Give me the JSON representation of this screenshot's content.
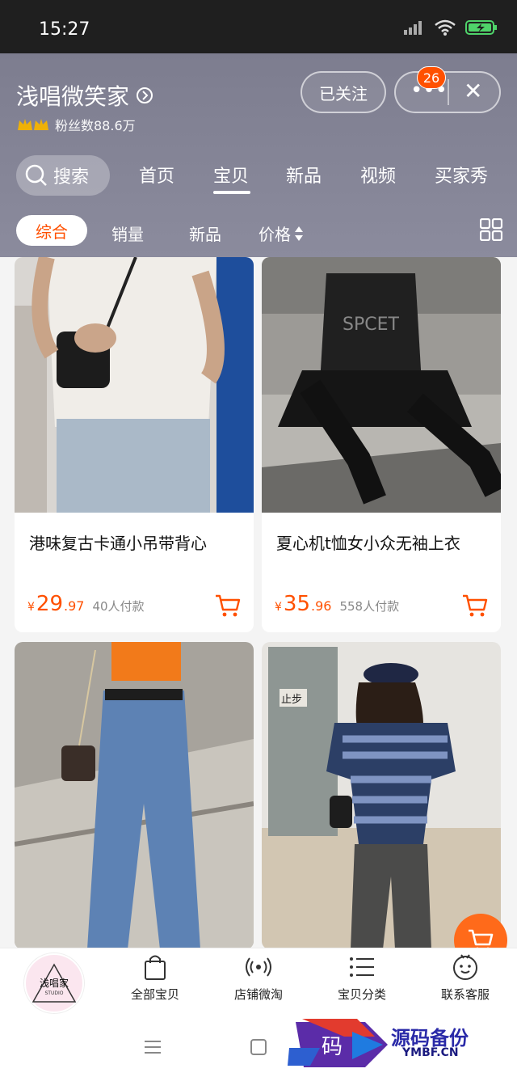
{
  "status": {
    "time": "15:27"
  },
  "shop": {
    "name": "浅唱微笑家",
    "fans": "粉丝数88.6万",
    "follow_label": "已关注",
    "badge_count": "26"
  },
  "nav": {
    "search_label": "搜索",
    "tabs": [
      "首页",
      "宝贝",
      "新品",
      "视频",
      "买家秀"
    ]
  },
  "filter": {
    "chips": [
      "综合",
      "销量",
      "新品",
      "价格"
    ]
  },
  "products": [
    {
      "title": "港味复古卡通小吊带背心",
      "price_yen": "¥",
      "price_int": "29",
      "price_dec": ".97",
      "paid": "40人付款"
    },
    {
      "title": "夏心机t恤女小众无袖上衣",
      "price_yen": "¥",
      "price_int": "35",
      "price_dec": ".96",
      "paid": "558人付款"
    },
    {
      "title": "",
      "price_yen": "",
      "price_int": "",
      "price_dec": "",
      "paid": ""
    },
    {
      "title": "",
      "price_yen": "",
      "price_int": "",
      "price_dec": "",
      "paid": ""
    }
  ],
  "bottom_tabs": [
    "全部宝贝",
    "店铺微淘",
    "宝贝分类",
    "联系客服"
  ],
  "logo_text": "浅唱家",
  "logo_sub": "STUDIO",
  "watermark": {
    "title": "源码备份",
    "url": "YMBF.CN",
    "glyph": "码"
  },
  "colors": {
    "accent": "#ff5000",
    "header": "#82828f"
  }
}
